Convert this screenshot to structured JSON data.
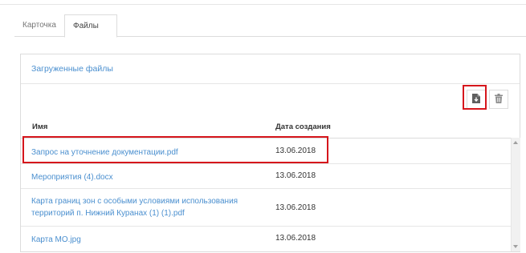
{
  "tabs": [
    {
      "label": "Карточка"
    },
    {
      "label": "Файлы"
    }
  ],
  "panel": {
    "title": "Загруженные файлы"
  },
  "toolbar": {
    "download_icon": "file-download-icon",
    "delete_icon": "trash-icon"
  },
  "table": {
    "columns": [
      "Имя",
      "Дата создания"
    ],
    "rows": [
      {
        "name": "Запрос на уточнение документации.pdf",
        "date": "13.06.2018"
      },
      {
        "name": "Мероприятия (4).docx",
        "date": "13.06.2018"
      },
      {
        "name": "Карта границ зон с особыми условиями использования территорий п. Нижний Куранах (1) (1).pdf",
        "date": "13.06.2018"
      },
      {
        "name": "Карта МО.jpg",
        "date": "13.06.2018"
      }
    ]
  },
  "colors": {
    "link": "#4a8fcf",
    "highlight": "#d6161c",
    "border": "#dcdcdc"
  }
}
